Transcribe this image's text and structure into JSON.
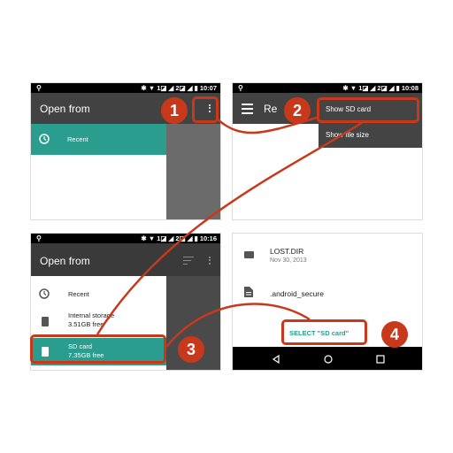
{
  "colors": {
    "accent": "#2a9d8f",
    "callout": "#c8391b",
    "appbar": "#424242"
  },
  "panel1": {
    "status_time": "10:07",
    "status_icons": "✱ ▼ 1◪ ◢ 2◪ ◢ ▮",
    "title": "Open from",
    "recent_label": "Recent",
    "callout_number": "1"
  },
  "panel2": {
    "status_time": "10:08",
    "status_icons": "✱ ▼ 1◪ ◢ 2◪ ◢ ▮",
    "title_partial": "Re",
    "menu_items": [
      "Show SD card",
      "Show file size"
    ],
    "callout_number": "2"
  },
  "panel3": {
    "status_time": "10:16",
    "status_icons": "✱ ▼ 1◪ ◢ 2◪ ◢ ▮",
    "title": "Open from",
    "items": [
      {
        "label": "Recent",
        "sub": "",
        "icon": "clock-icon"
      },
      {
        "label": "Internal storage",
        "sub": "3.51GB free",
        "icon": "sd-card-icon"
      },
      {
        "label": "SD card",
        "sub": "7.35GB free",
        "icon": "sd-card-icon"
      }
    ],
    "callout_number": "3"
  },
  "panel4": {
    "files": [
      {
        "name": "LOST.DIR",
        "date": "Nov 30, 2013",
        "icon": "folder-icon"
      },
      {
        "name": ".android_secure",
        "date": "",
        "icon": "file-icon"
      }
    ],
    "select_button": "SELECT \"SD card\"",
    "callout_number": "4"
  }
}
